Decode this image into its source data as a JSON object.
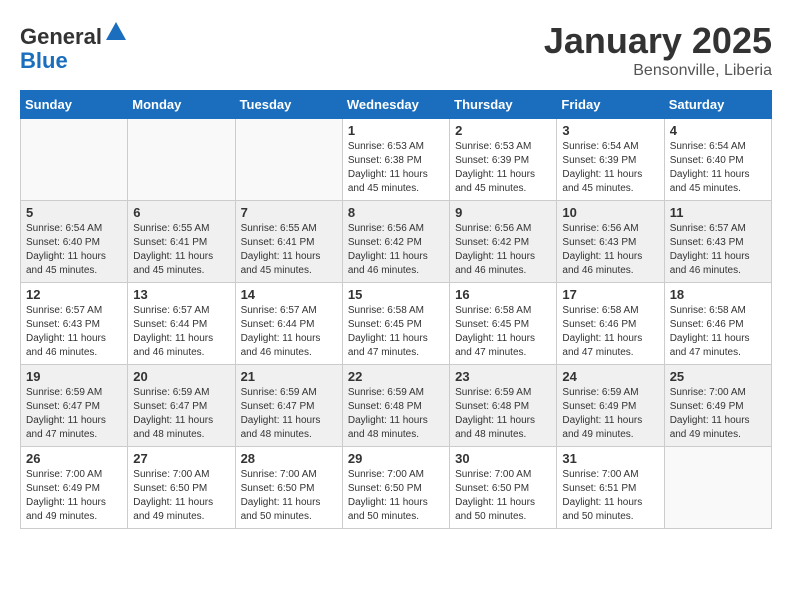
{
  "header": {
    "logo_general": "General",
    "logo_blue": "Blue",
    "month_title": "January 2025",
    "location": "Bensonville, Liberia"
  },
  "weekdays": [
    "Sunday",
    "Monday",
    "Tuesday",
    "Wednesday",
    "Thursday",
    "Friday",
    "Saturday"
  ],
  "weeks": [
    {
      "shaded": false,
      "days": [
        {
          "num": "",
          "info": ""
        },
        {
          "num": "",
          "info": ""
        },
        {
          "num": "",
          "info": ""
        },
        {
          "num": "1",
          "info": "Sunrise: 6:53 AM\nSunset: 6:38 PM\nDaylight: 11 hours\nand 45 minutes."
        },
        {
          "num": "2",
          "info": "Sunrise: 6:53 AM\nSunset: 6:39 PM\nDaylight: 11 hours\nand 45 minutes."
        },
        {
          "num": "3",
          "info": "Sunrise: 6:54 AM\nSunset: 6:39 PM\nDaylight: 11 hours\nand 45 minutes."
        },
        {
          "num": "4",
          "info": "Sunrise: 6:54 AM\nSunset: 6:40 PM\nDaylight: 11 hours\nand 45 minutes."
        }
      ]
    },
    {
      "shaded": true,
      "days": [
        {
          "num": "5",
          "info": "Sunrise: 6:54 AM\nSunset: 6:40 PM\nDaylight: 11 hours\nand 45 minutes."
        },
        {
          "num": "6",
          "info": "Sunrise: 6:55 AM\nSunset: 6:41 PM\nDaylight: 11 hours\nand 45 minutes."
        },
        {
          "num": "7",
          "info": "Sunrise: 6:55 AM\nSunset: 6:41 PM\nDaylight: 11 hours\nand 45 minutes."
        },
        {
          "num": "8",
          "info": "Sunrise: 6:56 AM\nSunset: 6:42 PM\nDaylight: 11 hours\nand 46 minutes."
        },
        {
          "num": "9",
          "info": "Sunrise: 6:56 AM\nSunset: 6:42 PM\nDaylight: 11 hours\nand 46 minutes."
        },
        {
          "num": "10",
          "info": "Sunrise: 6:56 AM\nSunset: 6:43 PM\nDaylight: 11 hours\nand 46 minutes."
        },
        {
          "num": "11",
          "info": "Sunrise: 6:57 AM\nSunset: 6:43 PM\nDaylight: 11 hours\nand 46 minutes."
        }
      ]
    },
    {
      "shaded": false,
      "days": [
        {
          "num": "12",
          "info": "Sunrise: 6:57 AM\nSunset: 6:43 PM\nDaylight: 11 hours\nand 46 minutes."
        },
        {
          "num": "13",
          "info": "Sunrise: 6:57 AM\nSunset: 6:44 PM\nDaylight: 11 hours\nand 46 minutes."
        },
        {
          "num": "14",
          "info": "Sunrise: 6:57 AM\nSunset: 6:44 PM\nDaylight: 11 hours\nand 46 minutes."
        },
        {
          "num": "15",
          "info": "Sunrise: 6:58 AM\nSunset: 6:45 PM\nDaylight: 11 hours\nand 47 minutes."
        },
        {
          "num": "16",
          "info": "Sunrise: 6:58 AM\nSunset: 6:45 PM\nDaylight: 11 hours\nand 47 minutes."
        },
        {
          "num": "17",
          "info": "Sunrise: 6:58 AM\nSunset: 6:46 PM\nDaylight: 11 hours\nand 47 minutes."
        },
        {
          "num": "18",
          "info": "Sunrise: 6:58 AM\nSunset: 6:46 PM\nDaylight: 11 hours\nand 47 minutes."
        }
      ]
    },
    {
      "shaded": true,
      "days": [
        {
          "num": "19",
          "info": "Sunrise: 6:59 AM\nSunset: 6:47 PM\nDaylight: 11 hours\nand 47 minutes."
        },
        {
          "num": "20",
          "info": "Sunrise: 6:59 AM\nSunset: 6:47 PM\nDaylight: 11 hours\nand 48 minutes."
        },
        {
          "num": "21",
          "info": "Sunrise: 6:59 AM\nSunset: 6:47 PM\nDaylight: 11 hours\nand 48 minutes."
        },
        {
          "num": "22",
          "info": "Sunrise: 6:59 AM\nSunset: 6:48 PM\nDaylight: 11 hours\nand 48 minutes."
        },
        {
          "num": "23",
          "info": "Sunrise: 6:59 AM\nSunset: 6:48 PM\nDaylight: 11 hours\nand 48 minutes."
        },
        {
          "num": "24",
          "info": "Sunrise: 6:59 AM\nSunset: 6:49 PM\nDaylight: 11 hours\nand 49 minutes."
        },
        {
          "num": "25",
          "info": "Sunrise: 7:00 AM\nSunset: 6:49 PM\nDaylight: 11 hours\nand 49 minutes."
        }
      ]
    },
    {
      "shaded": false,
      "days": [
        {
          "num": "26",
          "info": "Sunrise: 7:00 AM\nSunset: 6:49 PM\nDaylight: 11 hours\nand 49 minutes."
        },
        {
          "num": "27",
          "info": "Sunrise: 7:00 AM\nSunset: 6:50 PM\nDaylight: 11 hours\nand 49 minutes."
        },
        {
          "num": "28",
          "info": "Sunrise: 7:00 AM\nSunset: 6:50 PM\nDaylight: 11 hours\nand 50 minutes."
        },
        {
          "num": "29",
          "info": "Sunrise: 7:00 AM\nSunset: 6:50 PM\nDaylight: 11 hours\nand 50 minutes."
        },
        {
          "num": "30",
          "info": "Sunrise: 7:00 AM\nSunset: 6:50 PM\nDaylight: 11 hours\nand 50 minutes."
        },
        {
          "num": "31",
          "info": "Sunrise: 7:00 AM\nSunset: 6:51 PM\nDaylight: 11 hours\nand 50 minutes."
        },
        {
          "num": "",
          "info": ""
        }
      ]
    }
  ]
}
